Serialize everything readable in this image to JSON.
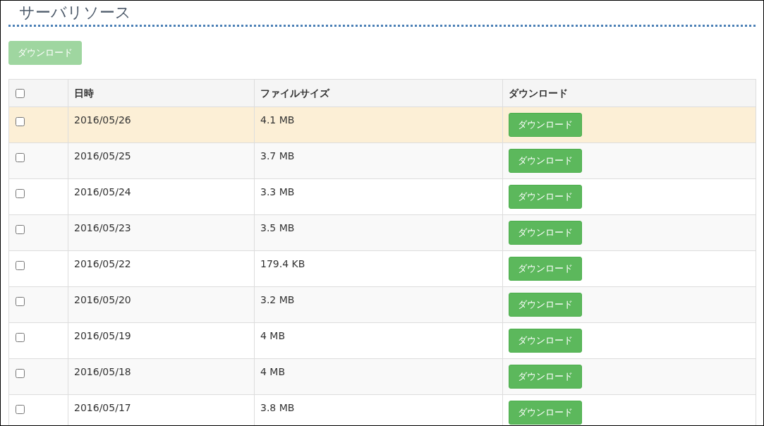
{
  "title": "サーバリソース",
  "bulk_button": {
    "label": "ダウンロード",
    "disabled": true
  },
  "table": {
    "header_checkbox": {
      "checked": false
    },
    "columns": [
      "日時",
      "ファイルサイズ",
      "ダウンロード"
    ],
    "rows": [
      {
        "checked": false,
        "highlighted": true,
        "date": "2016/05/26",
        "size": "4.1 MB",
        "button": "ダウンロード"
      },
      {
        "checked": false,
        "highlighted": false,
        "date": "2016/05/25",
        "size": "3.7 MB",
        "button": "ダウンロード"
      },
      {
        "checked": false,
        "highlighted": false,
        "date": "2016/05/24",
        "size": "3.3 MB",
        "button": "ダウンロード"
      },
      {
        "checked": false,
        "highlighted": false,
        "date": "2016/05/23",
        "size": "3.5 MB",
        "button": "ダウンロード"
      },
      {
        "checked": false,
        "highlighted": false,
        "date": "2016/05/22",
        "size": "179.4 KB",
        "button": "ダウンロード"
      },
      {
        "checked": false,
        "highlighted": false,
        "date": "2016/05/20",
        "size": "3.2 MB",
        "button": "ダウンロード"
      },
      {
        "checked": false,
        "highlighted": false,
        "date": "2016/05/19",
        "size": "4 MB",
        "button": "ダウンロード"
      },
      {
        "checked": false,
        "highlighted": false,
        "date": "2016/05/18",
        "size": "4 MB",
        "button": "ダウンロード"
      },
      {
        "checked": false,
        "highlighted": false,
        "date": "2016/05/17",
        "size": "3.8 MB",
        "button": "ダウンロード"
      }
    ]
  }
}
